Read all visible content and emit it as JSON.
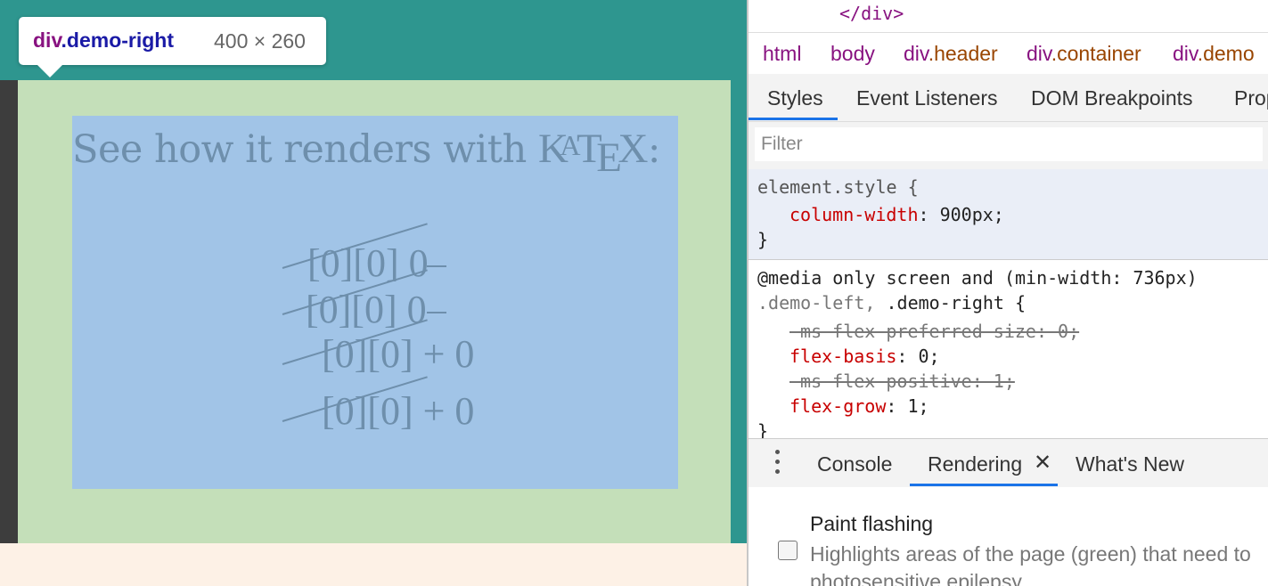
{
  "page": {
    "heading_text": "See how it renders with ",
    "heading_logo": {
      "k": "K",
      "a": "A",
      "t": "T",
      "e": "E",
      "x": "X"
    },
    "heading_colon": ":",
    "math_lines": [
      {
        "text": "[0][0]  0"
      },
      {
        "text": "[0][0]  0"
      },
      {
        "text": "[0][0] + 0"
      },
      {
        "text": "[0][0] + 0"
      }
    ]
  },
  "tooltip": {
    "tag": "div",
    "class": ".demo-right",
    "size": "400 × 260"
  },
  "devtools": {
    "closing_tag": "</div>",
    "breadcrumbs": [
      {
        "tag": "html",
        "class": ""
      },
      {
        "tag": "body",
        "class": ""
      },
      {
        "tag": "div",
        "class": ".header"
      },
      {
        "tag": "div",
        "class": ".container"
      },
      {
        "tag": "div",
        "class": ".demo"
      }
    ],
    "styles_tabs": [
      "Styles",
      "Event Listeners",
      "DOM Breakpoints",
      "Prop"
    ],
    "filter_placeholder": "Filter",
    "element_style": {
      "selector": "element.style {",
      "prop": "column-width",
      "value": ": 900px;",
      "close": "}"
    },
    "media_rule": {
      "media": "@media only screen and (min-width: 736px)",
      "selector_a": ".demo-left, ",
      "selector_b": ".demo-right {",
      "decls": [
        {
          "text": "-ms-flex-preferred-size: 0;"
        },
        {
          "prop": "flex-basis",
          "value": ": 0;"
        },
        {
          "text": "-ms-flex-positive: 1;"
        },
        {
          "prop": "flex-grow",
          "value": ": 1;"
        }
      ],
      "close": "}"
    },
    "drawer_tabs": [
      "Console",
      "Rendering",
      "What's New"
    ],
    "rendering": {
      "title": "Paint flashing",
      "desc_line1": "Highlights areas of the page (green) that need to",
      "desc_line2": "photosensitive epilepsy"
    }
  }
}
